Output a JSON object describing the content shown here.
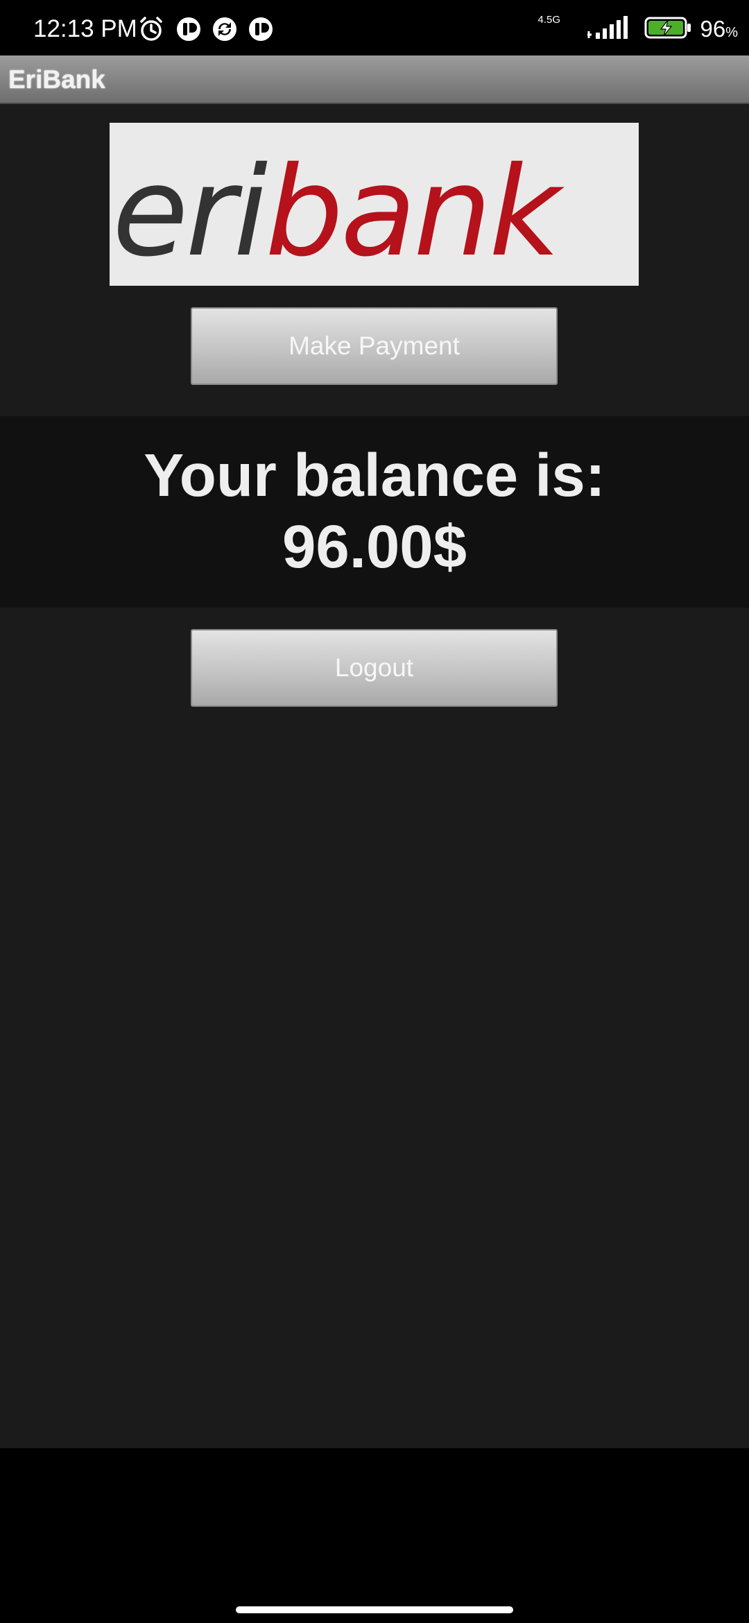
{
  "status_bar": {
    "time": "12:13 PM",
    "network_label": "4.5G",
    "battery_percent": "96",
    "battery_unit": "%",
    "icons": [
      "alarm-icon",
      "notification-app-icon",
      "sync-app-icon",
      "notification-app-icon",
      "signal-icon",
      "battery-charging-icon"
    ],
    "battery_color": "#4caf2a"
  },
  "app": {
    "title": "EriBank",
    "logo": {
      "text_part1": "eri",
      "text_part2": "bank",
      "color_part1": "#333333",
      "color_part2": "#b5121b"
    }
  },
  "main": {
    "make_payment_label": "Make Payment",
    "balance_line1": "Your balance is:",
    "balance_line2": "96.00$",
    "logout_label": "Logout"
  }
}
